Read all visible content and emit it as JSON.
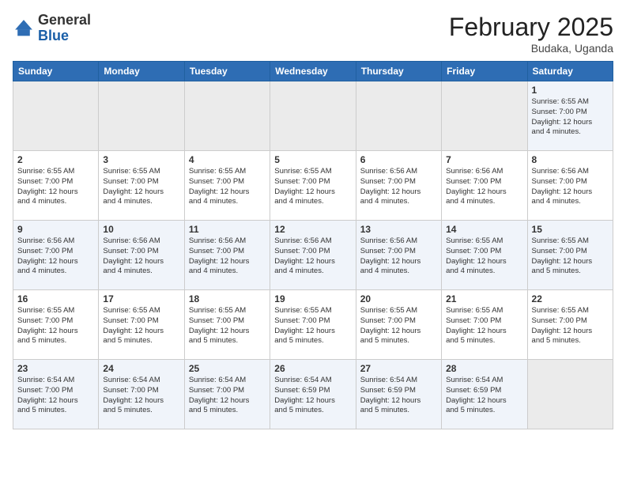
{
  "header": {
    "logo_general": "General",
    "logo_blue": "Blue",
    "title": "February 2025",
    "subtitle": "Budaka, Uganda"
  },
  "weekdays": [
    "Sunday",
    "Monday",
    "Tuesday",
    "Wednesday",
    "Thursday",
    "Friday",
    "Saturday"
  ],
  "weeks": [
    [
      {
        "day": "",
        "info": ""
      },
      {
        "day": "",
        "info": ""
      },
      {
        "day": "",
        "info": ""
      },
      {
        "day": "",
        "info": ""
      },
      {
        "day": "",
        "info": ""
      },
      {
        "day": "",
        "info": ""
      },
      {
        "day": "1",
        "info": "Sunrise: 6:55 AM\nSunset: 7:00 PM\nDaylight: 12 hours\nand 4 minutes."
      }
    ],
    [
      {
        "day": "2",
        "info": "Sunrise: 6:55 AM\nSunset: 7:00 PM\nDaylight: 12 hours\nand 4 minutes."
      },
      {
        "day": "3",
        "info": "Sunrise: 6:55 AM\nSunset: 7:00 PM\nDaylight: 12 hours\nand 4 minutes."
      },
      {
        "day": "4",
        "info": "Sunrise: 6:55 AM\nSunset: 7:00 PM\nDaylight: 12 hours\nand 4 minutes."
      },
      {
        "day": "5",
        "info": "Sunrise: 6:55 AM\nSunset: 7:00 PM\nDaylight: 12 hours\nand 4 minutes."
      },
      {
        "day": "6",
        "info": "Sunrise: 6:56 AM\nSunset: 7:00 PM\nDaylight: 12 hours\nand 4 minutes."
      },
      {
        "day": "7",
        "info": "Sunrise: 6:56 AM\nSunset: 7:00 PM\nDaylight: 12 hours\nand 4 minutes."
      },
      {
        "day": "8",
        "info": "Sunrise: 6:56 AM\nSunset: 7:00 PM\nDaylight: 12 hours\nand 4 minutes."
      }
    ],
    [
      {
        "day": "9",
        "info": "Sunrise: 6:56 AM\nSunset: 7:00 PM\nDaylight: 12 hours\nand 4 minutes."
      },
      {
        "day": "10",
        "info": "Sunrise: 6:56 AM\nSunset: 7:00 PM\nDaylight: 12 hours\nand 4 minutes."
      },
      {
        "day": "11",
        "info": "Sunrise: 6:56 AM\nSunset: 7:00 PM\nDaylight: 12 hours\nand 4 minutes."
      },
      {
        "day": "12",
        "info": "Sunrise: 6:56 AM\nSunset: 7:00 PM\nDaylight: 12 hours\nand 4 minutes."
      },
      {
        "day": "13",
        "info": "Sunrise: 6:56 AM\nSunset: 7:00 PM\nDaylight: 12 hours\nand 4 minutes."
      },
      {
        "day": "14",
        "info": "Sunrise: 6:55 AM\nSunset: 7:00 PM\nDaylight: 12 hours\nand 4 minutes."
      },
      {
        "day": "15",
        "info": "Sunrise: 6:55 AM\nSunset: 7:00 PM\nDaylight: 12 hours\nand 5 minutes."
      }
    ],
    [
      {
        "day": "16",
        "info": "Sunrise: 6:55 AM\nSunset: 7:00 PM\nDaylight: 12 hours\nand 5 minutes."
      },
      {
        "day": "17",
        "info": "Sunrise: 6:55 AM\nSunset: 7:00 PM\nDaylight: 12 hours\nand 5 minutes."
      },
      {
        "day": "18",
        "info": "Sunrise: 6:55 AM\nSunset: 7:00 PM\nDaylight: 12 hours\nand 5 minutes."
      },
      {
        "day": "19",
        "info": "Sunrise: 6:55 AM\nSunset: 7:00 PM\nDaylight: 12 hours\nand 5 minutes."
      },
      {
        "day": "20",
        "info": "Sunrise: 6:55 AM\nSunset: 7:00 PM\nDaylight: 12 hours\nand 5 minutes."
      },
      {
        "day": "21",
        "info": "Sunrise: 6:55 AM\nSunset: 7:00 PM\nDaylight: 12 hours\nand 5 minutes."
      },
      {
        "day": "22",
        "info": "Sunrise: 6:55 AM\nSunset: 7:00 PM\nDaylight: 12 hours\nand 5 minutes."
      }
    ],
    [
      {
        "day": "23",
        "info": "Sunrise: 6:54 AM\nSunset: 7:00 PM\nDaylight: 12 hours\nand 5 minutes."
      },
      {
        "day": "24",
        "info": "Sunrise: 6:54 AM\nSunset: 7:00 PM\nDaylight: 12 hours\nand 5 minutes."
      },
      {
        "day": "25",
        "info": "Sunrise: 6:54 AM\nSunset: 7:00 PM\nDaylight: 12 hours\nand 5 minutes."
      },
      {
        "day": "26",
        "info": "Sunrise: 6:54 AM\nSunset: 6:59 PM\nDaylight: 12 hours\nand 5 minutes."
      },
      {
        "day": "27",
        "info": "Sunrise: 6:54 AM\nSunset: 6:59 PM\nDaylight: 12 hours\nand 5 minutes."
      },
      {
        "day": "28",
        "info": "Sunrise: 6:54 AM\nSunset: 6:59 PM\nDaylight: 12 hours\nand 5 minutes."
      },
      {
        "day": "",
        "info": ""
      }
    ]
  ]
}
